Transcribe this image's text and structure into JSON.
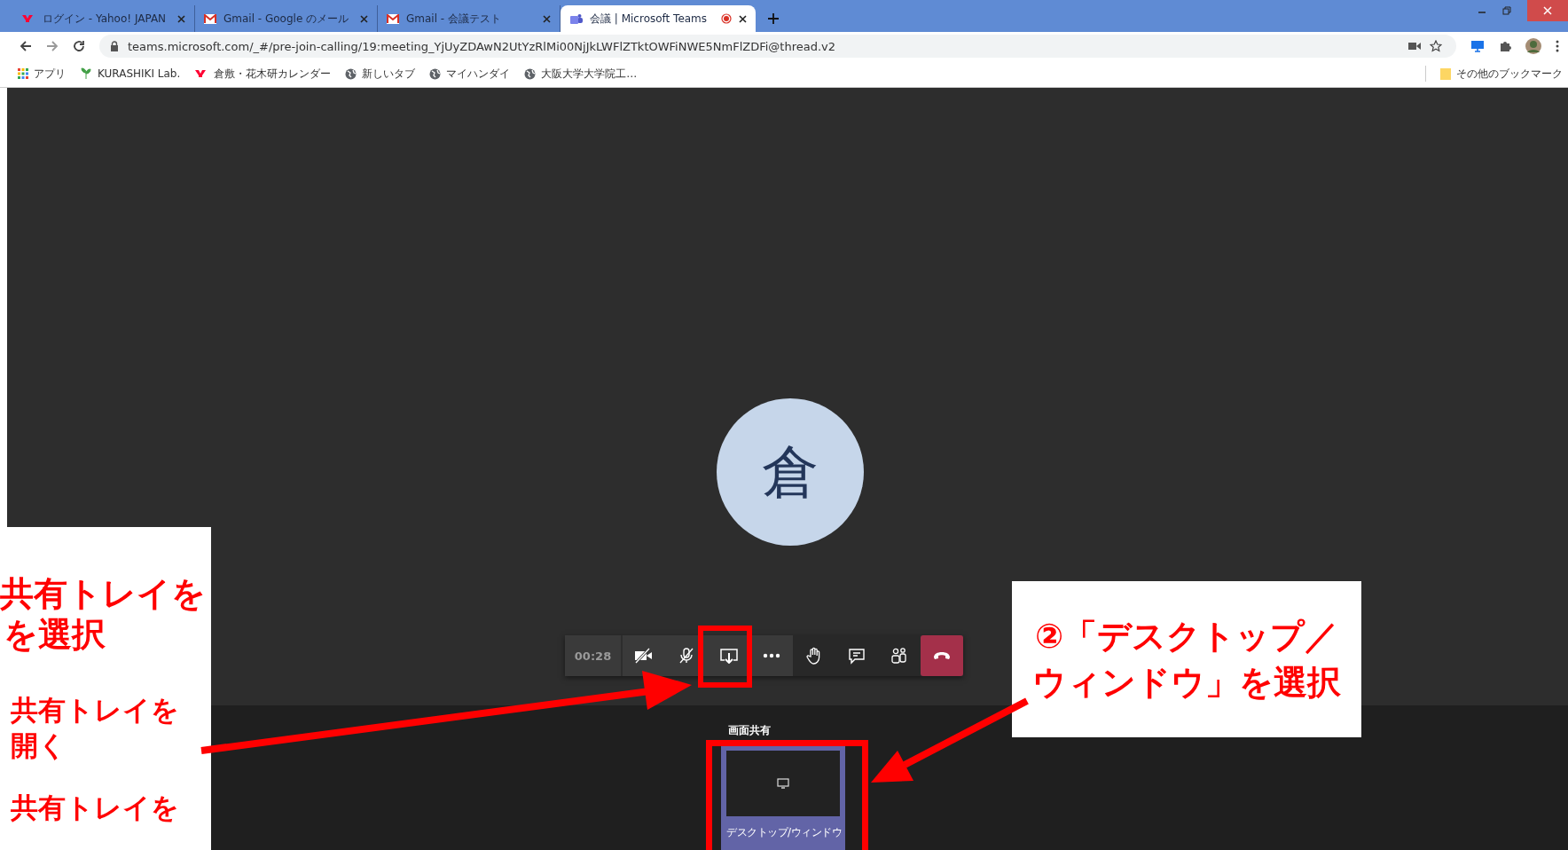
{
  "browser": {
    "tabs": [
      {
        "title": "ログイン - Yahoo! JAPAN",
        "kind": "yahoo",
        "selected": false,
        "recording": false
      },
      {
        "title": "Gmail - Google のメール",
        "kind": "gmail",
        "selected": false,
        "recording": false
      },
      {
        "title": "Gmail - 会議テスト",
        "kind": "gmail",
        "selected": false,
        "recording": false
      },
      {
        "title": "会議 | Microsoft Teams",
        "kind": "teams",
        "selected": true,
        "recording": true
      }
    ],
    "address": "teams.microsoft.com/_#/pre-join-calling/19:meeting_YjUyZDAwN2UtYzRlMi00NjJkLWFlZTktOWFiNWE5NmFlZDFi@thread.v2",
    "bookmarks": [
      {
        "label": "アプリ",
        "kind": "apps"
      },
      {
        "label": "KURASHIKI Lab.",
        "kind": "leaf"
      },
      {
        "label": "倉敷・花木研カレンダー",
        "kind": "yahoo"
      },
      {
        "label": "新しいタブ",
        "kind": "globe"
      },
      {
        "label": "マイハンダイ",
        "kind": "globe"
      },
      {
        "label": "大阪大学大学院工…",
        "kind": "globe"
      }
    ],
    "other_bookmarks": "その他のブックマーク"
  },
  "call": {
    "avatar": "倉",
    "timer": "00:28",
    "controls": [
      {
        "kind": "camera"
      },
      {
        "kind": "mic"
      },
      {
        "kind": "share"
      },
      {
        "kind": "more"
      },
      {
        "kind": "hand"
      },
      {
        "kind": "chat"
      },
      {
        "kind": "people"
      },
      {
        "kind": "hangup"
      }
    ],
    "tray": {
      "title": "画面共有",
      "options": [
        {
          "label": "デスクトップ/ウィンドウ",
          "selected": true
        }
      ]
    }
  },
  "annotations": {
    "left": [
      "共有トレイを",
      "を選択",
      "共有トレイを開く",
      "共有トレイを"
    ],
    "right": [
      "②「デスクトップ／",
      "ウィンドウ」を選択"
    ]
  }
}
